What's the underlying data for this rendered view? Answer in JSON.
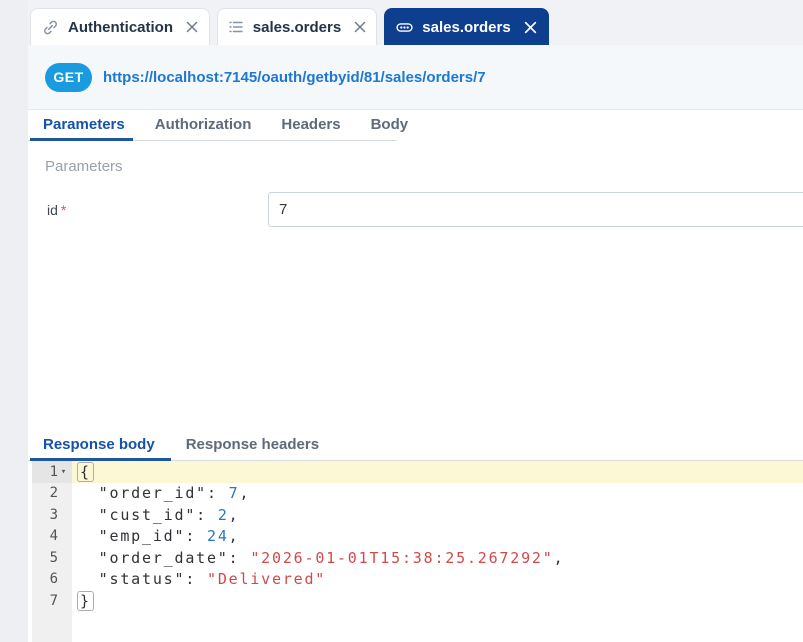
{
  "doc_tabs": [
    {
      "label": "Authentication",
      "icon": "link-icon",
      "active": false
    },
    {
      "label": "sales.orders",
      "icon": "list-icon",
      "active": false
    },
    {
      "label": "sales.orders",
      "icon": "connection-icon",
      "active": true
    }
  ],
  "request": {
    "method": "GET",
    "url": "https://localhost:7145/oauth/getbyid/81/sales/orders/7",
    "tabs": [
      "Parameters",
      "Authorization",
      "Headers",
      "Body"
    ],
    "active_tab": "Parameters",
    "section_label": "Parameters",
    "params": [
      {
        "name": "id",
        "required": true,
        "value": "7"
      }
    ]
  },
  "response": {
    "tabs": [
      "Response body",
      "Response headers"
    ],
    "active_tab": "Response body",
    "body_lines": [
      {
        "num": "1",
        "fold": true,
        "highlight": true,
        "tokens": [
          {
            "text": "{",
            "type": "plain",
            "boxed": true
          }
        ]
      },
      {
        "num": "2",
        "fold": false,
        "highlight": false,
        "tokens": [
          {
            "text": "  ",
            "type": "plain"
          },
          {
            "text": "\"order_id\"",
            "type": "plain"
          },
          {
            "text": ": ",
            "type": "plain"
          },
          {
            "text": "7",
            "type": "num"
          },
          {
            "text": ",",
            "type": "plain"
          }
        ]
      },
      {
        "num": "3",
        "fold": false,
        "highlight": false,
        "tokens": [
          {
            "text": "  ",
            "type": "plain"
          },
          {
            "text": "\"cust_id\"",
            "type": "plain"
          },
          {
            "text": ": ",
            "type": "plain"
          },
          {
            "text": "2",
            "type": "num"
          },
          {
            "text": ",",
            "type": "plain"
          }
        ]
      },
      {
        "num": "4",
        "fold": false,
        "highlight": false,
        "tokens": [
          {
            "text": "  ",
            "type": "plain"
          },
          {
            "text": "\"emp_id\"",
            "type": "plain"
          },
          {
            "text": ": ",
            "type": "plain"
          },
          {
            "text": "24",
            "type": "num"
          },
          {
            "text": ",",
            "type": "plain"
          }
        ]
      },
      {
        "num": "5",
        "fold": false,
        "highlight": false,
        "tokens": [
          {
            "text": "  ",
            "type": "plain"
          },
          {
            "text": "\"order_date\"",
            "type": "plain"
          },
          {
            "text": ": ",
            "type": "plain"
          },
          {
            "text": "\"2026-01-01T15:38:25.267292\"",
            "type": "str"
          },
          {
            "text": ",",
            "type": "plain"
          }
        ]
      },
      {
        "num": "6",
        "fold": false,
        "highlight": false,
        "tokens": [
          {
            "text": "  ",
            "type": "plain"
          },
          {
            "text": "\"status\"",
            "type": "plain"
          },
          {
            "text": ": ",
            "type": "plain"
          },
          {
            "text": "\"Delivered\"",
            "type": "str"
          }
        ]
      },
      {
        "num": "7",
        "fold": false,
        "highlight": false,
        "tokens": [
          {
            "text": "}",
            "type": "plain",
            "boxed": true
          }
        ]
      }
    ]
  },
  "colors": {
    "active_doc_tab": "#0e3e8e",
    "method_badge": "#1a9be0",
    "url_link": "#1c78d2",
    "active_tab_text": "#1553a8",
    "tab_underline": "#1e56a0",
    "highlight_line": "#fcf7d4",
    "code_number": "#2f74c0",
    "code_string": "#d2494a"
  }
}
